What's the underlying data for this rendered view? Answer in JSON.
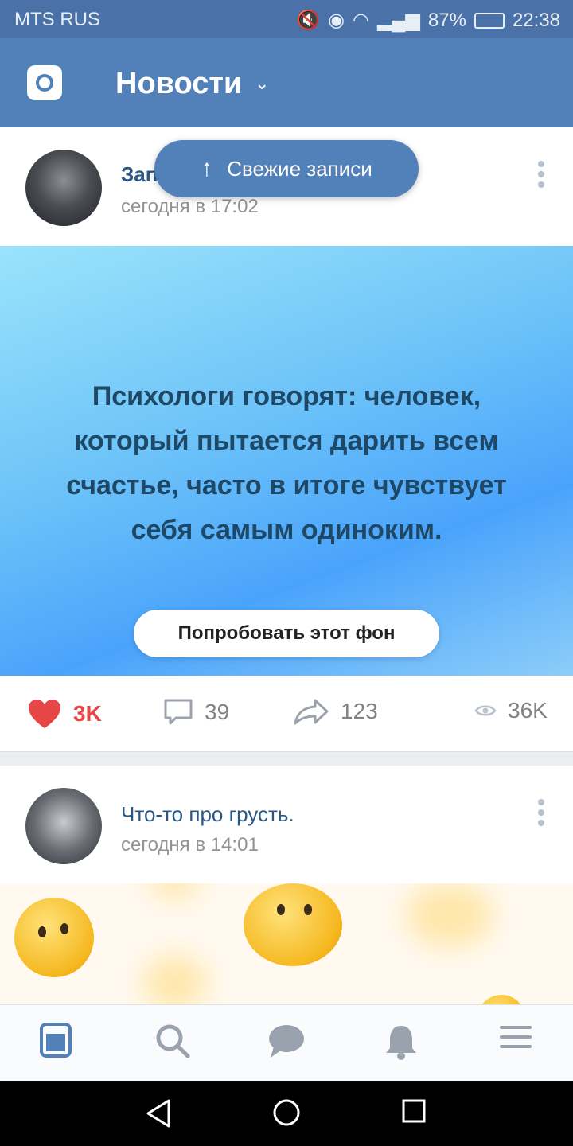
{
  "status_bar": {
    "carrier": "MTS RUS",
    "battery": "87%",
    "time": "22:38"
  },
  "app_bar": {
    "title": "Новости"
  },
  "fresh_button": {
    "label": "Свежие записи"
  },
  "post1": {
    "author": "Записи",
    "time": "сегодня в 17:02",
    "quote": "Психологи говорят: человек, который пытается дарить всем счастье, часто в итоге чувствует себя самым одиноким.",
    "try_background": "Попробовать этот фон",
    "likes": "3K",
    "comments": "39",
    "shares": "123",
    "views": "36K"
  },
  "post2": {
    "author": "Что-то про грусть.",
    "time": "сегодня в 14:01"
  },
  "colors": {
    "brand": "#5181b8",
    "like": "#e64646"
  }
}
